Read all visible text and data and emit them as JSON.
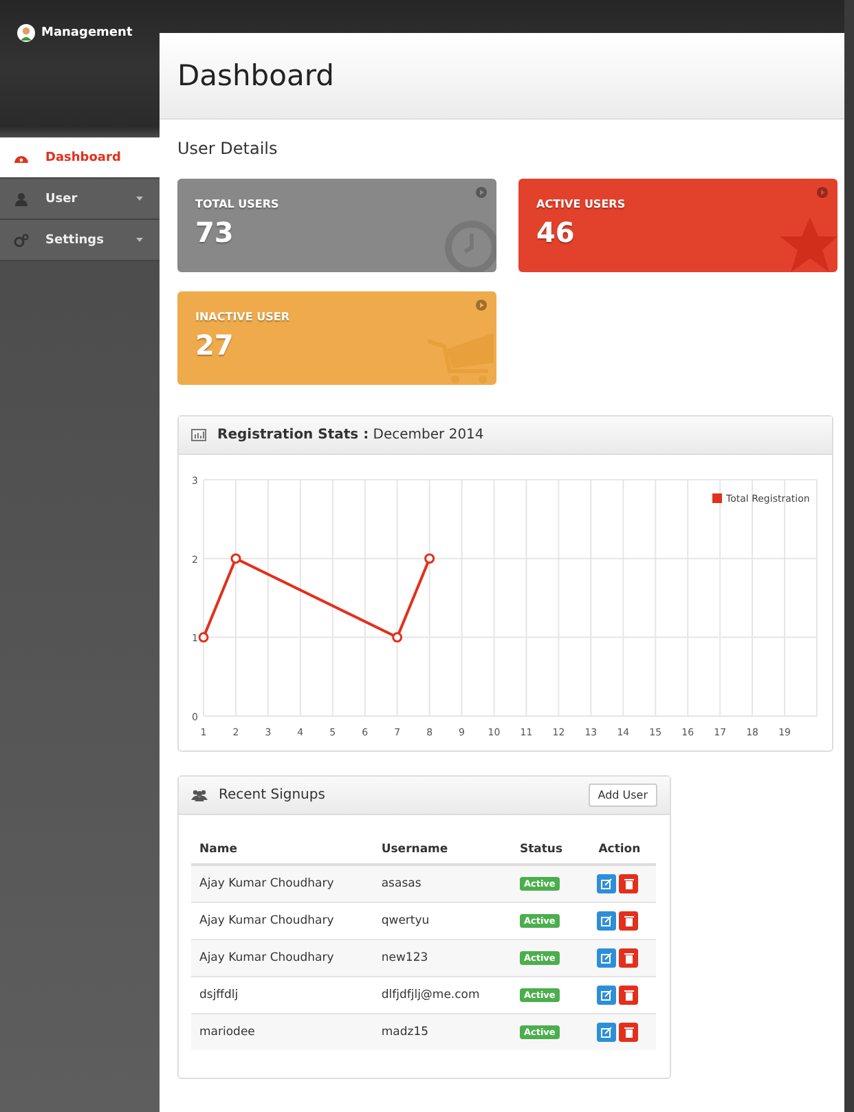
{
  "brand": {
    "name": "Management"
  },
  "sidebar": {
    "items": [
      {
        "label": "Dashboard",
        "kind": "gauge",
        "selected": true,
        "submenu": false
      },
      {
        "label": "User",
        "kind": "user",
        "selected": false,
        "submenu": true
      },
      {
        "label": "Settings",
        "kind": "gears",
        "selected": false,
        "submenu": true
      }
    ]
  },
  "page": {
    "title": "Dashboard",
    "section": "User Details"
  },
  "stats": [
    {
      "label": "TOTAL USERS",
      "value": "73",
      "color": "#888888",
      "kind": "clock"
    },
    {
      "label": "ACTIVE USERS",
      "value": "46",
      "color": "#e2412c",
      "kind": "star"
    },
    {
      "label": "INACTIVE USER",
      "value": "27",
      "color": "#efab4b",
      "kind": "cart"
    }
  ],
  "registration_panel": {
    "title": "Registration Stats :",
    "subtitle": "December 2014",
    "chart_data": {
      "type": "line",
      "x": [
        1,
        2,
        7,
        8
      ],
      "series": [
        {
          "name": "Total Registration",
          "color": "#e2301c",
          "marker": "circle",
          "values": [
            1,
            2,
            1,
            2
          ]
        }
      ],
      "grid": true,
      "xlim": [
        1,
        20
      ],
      "ylim": [
        0,
        3
      ],
      "xticks": [
        1,
        2,
        3,
        4,
        5,
        6,
        7,
        8,
        9,
        10,
        11,
        12,
        13,
        14,
        15,
        16,
        17,
        18,
        19
      ],
      "yticks": [
        0,
        1,
        2,
        3
      ]
    }
  },
  "signups_panel": {
    "title": "Recent Signups",
    "add_button": "Add User",
    "columns": [
      "Name",
      "Username",
      "Status",
      "Action"
    ],
    "rows": [
      {
        "name": "Ajay Kumar Choudhary",
        "username": "asasas",
        "status": "Active"
      },
      {
        "name": "Ajay Kumar Choudhary",
        "username": "qwertyu",
        "status": "Active"
      },
      {
        "name": "Ajay Kumar Choudhary",
        "username": "new123",
        "status": "Active"
      },
      {
        "name": "dsjffdlj",
        "username": "dlfjdfjlj@me.com",
        "status": "Active"
      },
      {
        "name": "mariodee",
        "username": "madz15",
        "status": "Active"
      }
    ]
  }
}
